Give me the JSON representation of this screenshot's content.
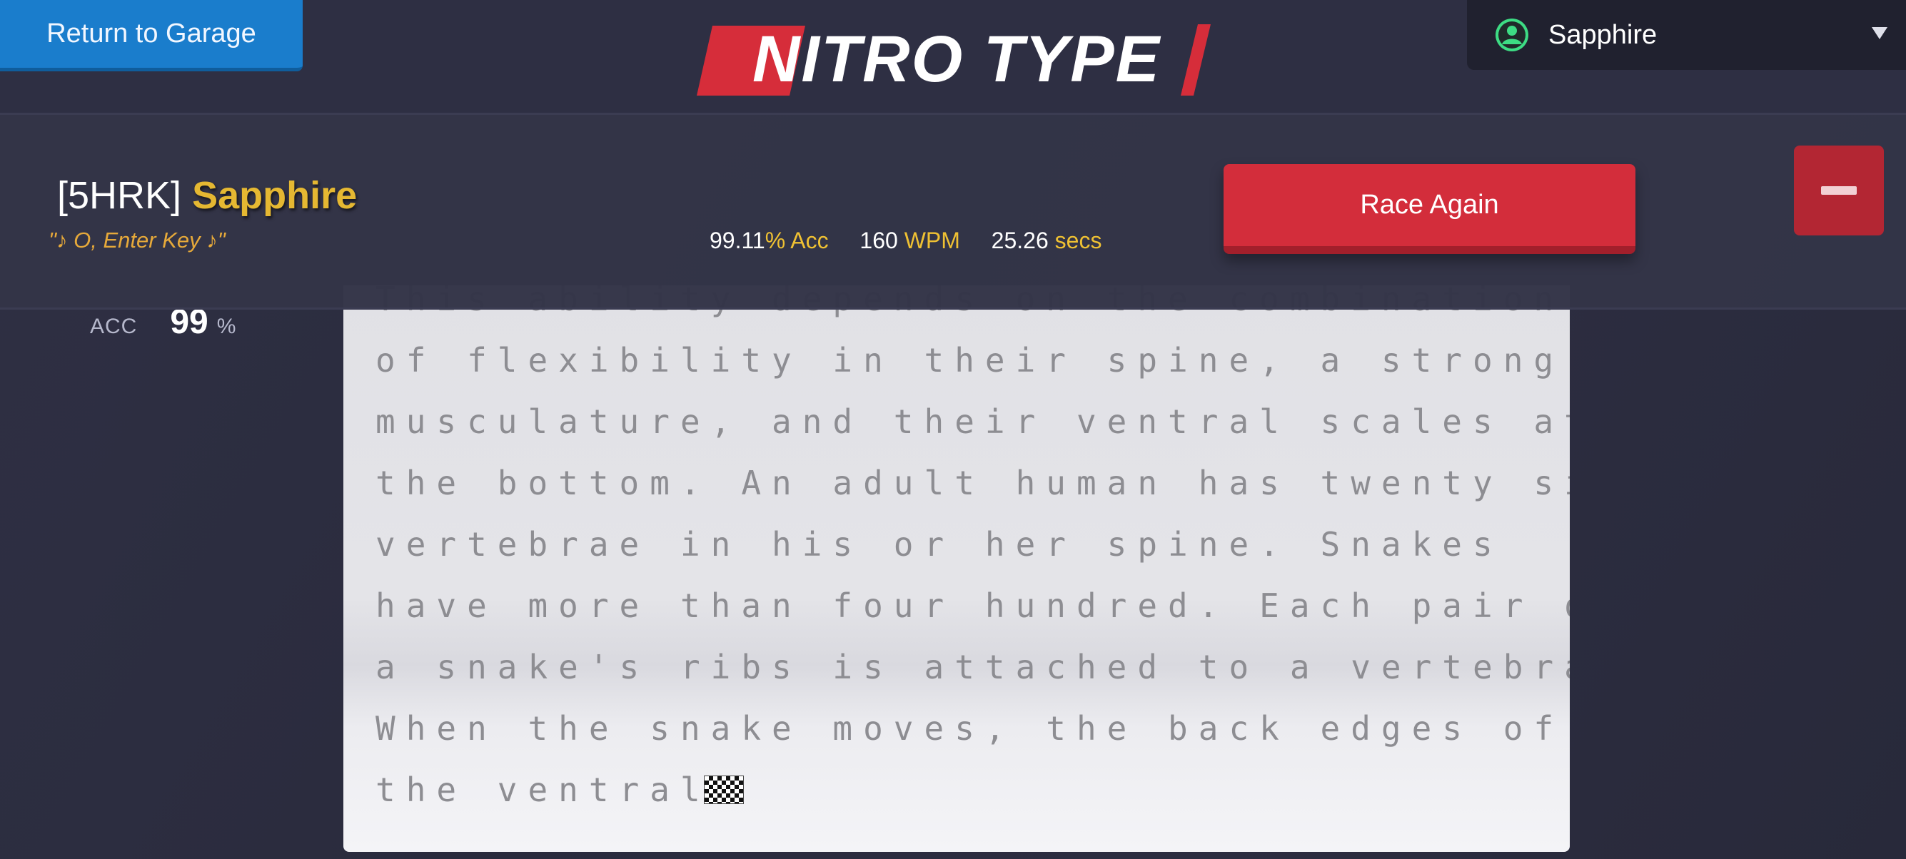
{
  "header": {
    "return_label": "Return to Garage",
    "logo_text": "NITRO TYPE",
    "user_menu_name": "Sapphire"
  },
  "results": {
    "team_tag": "[5HRK]",
    "player_name": "Sapphire",
    "player_title": "\"♪ O, Enter Key ♪\"",
    "accuracy_value": "99.11",
    "accuracy_unit": "% Acc",
    "wpm_value": "160",
    "wpm_unit": "WPM",
    "time_value": "25.26",
    "time_unit": "secs",
    "race_again_label": "Race Again"
  },
  "sidebar_stats": {
    "acc_label": "ACC",
    "acc_value": "99",
    "acc_unit": "%"
  },
  "race_text": {
    "lines": [
      "This ability depends on the combination",
      "of flexibility in their spine, a strong",
      "musculature, and their ventral scales at",
      "the bottom. An adult human has twenty six",
      "vertebrae in his or her spine. Snakes",
      "have more than four hundred. Each pair of",
      "a snake's ribs is attached to a vertebra.",
      "When the snake moves, the back edges of",
      "the ventral"
    ],
    "finish_icon": "checkered-flag-icon"
  },
  "colors": {
    "return_button": "#1a7dcc",
    "race_again_button": "#d32d3b",
    "player_name": "#e5b832",
    "stat_unit": "#efc133",
    "user_icon": "#3ddc84"
  }
}
